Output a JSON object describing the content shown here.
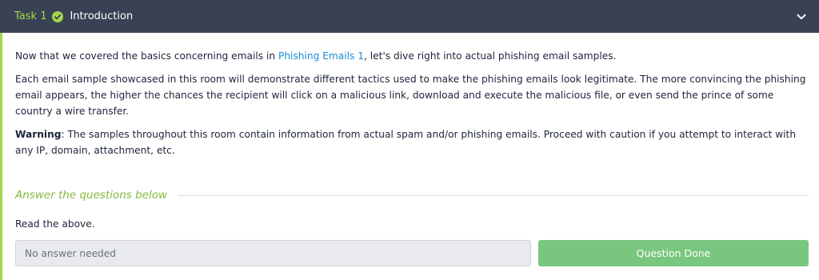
{
  "task": {
    "number": "Task 1",
    "title": "Introduction",
    "accent_color": "#a3d64b",
    "header_bg": "#394254",
    "status_icon": "check-circle-icon",
    "toggle_icon": "chevron-down-icon"
  },
  "body": {
    "intro_before": "Now that we covered the basics concerning emails in ",
    "intro_link": "Phishing Emails 1",
    "intro_after": ", let's dive right into actual phishing email samples.",
    "paragraph2": "Each email sample showcased in this room will demonstrate different tactics used to make the phishing emails look legitimate. The more convincing the phishing email appears, the higher the chances the recipient will click on a malicious link, download and execute the malicious file, or even send the prince of some country a wire transfer.",
    "warning_label": "Warning",
    "warning_text": ": The samples throughout this room contain information from actual spam and/or phishing emails. Proceed with caution if you attempt to interact with any IP, domain, attachment, etc."
  },
  "answers": {
    "heading": "Answer the questions below",
    "question": "Read the above.",
    "input_placeholder": "No answer needed",
    "submit_label": "Question Done",
    "submit_color": "#79c77e"
  }
}
